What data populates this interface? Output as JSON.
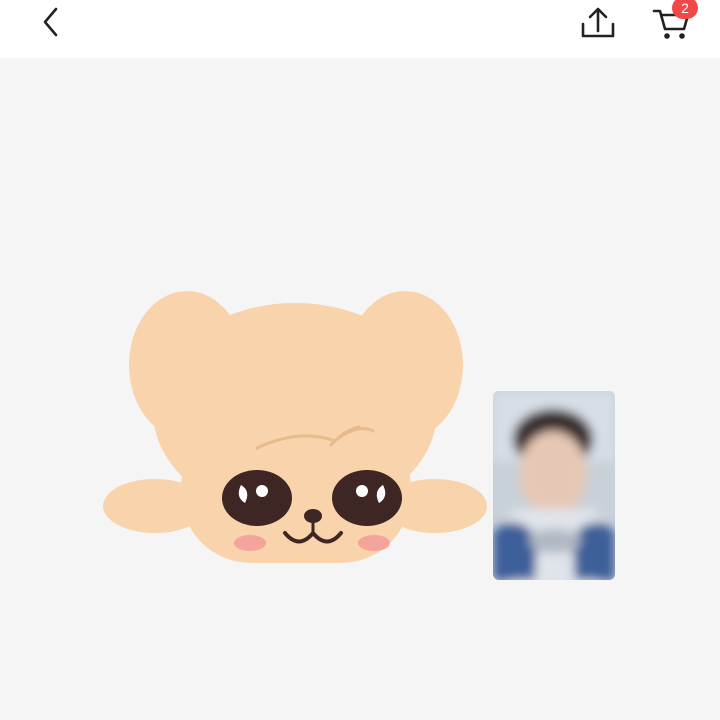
{
  "header": {
    "back_icon": "chevron-left-icon",
    "share_icon": "share-upload-icon",
    "cart_icon": "cart-icon",
    "cart_count": "2"
  },
  "colors": {
    "header_bg": "#ffffff",
    "page_bg": "#f5f5f5",
    "icon": "#222222",
    "badge": "#f04848",
    "mascot_fur": "#f8d3ac",
    "mascot_fur_shade": "#f2c79c",
    "mascot_eye": "#3e2624",
    "mascot_cheek": "#f5a49c"
  },
  "product": {
    "image": "puppy-mascot-illustration",
    "photocard": "blurred-photocard-image"
  }
}
